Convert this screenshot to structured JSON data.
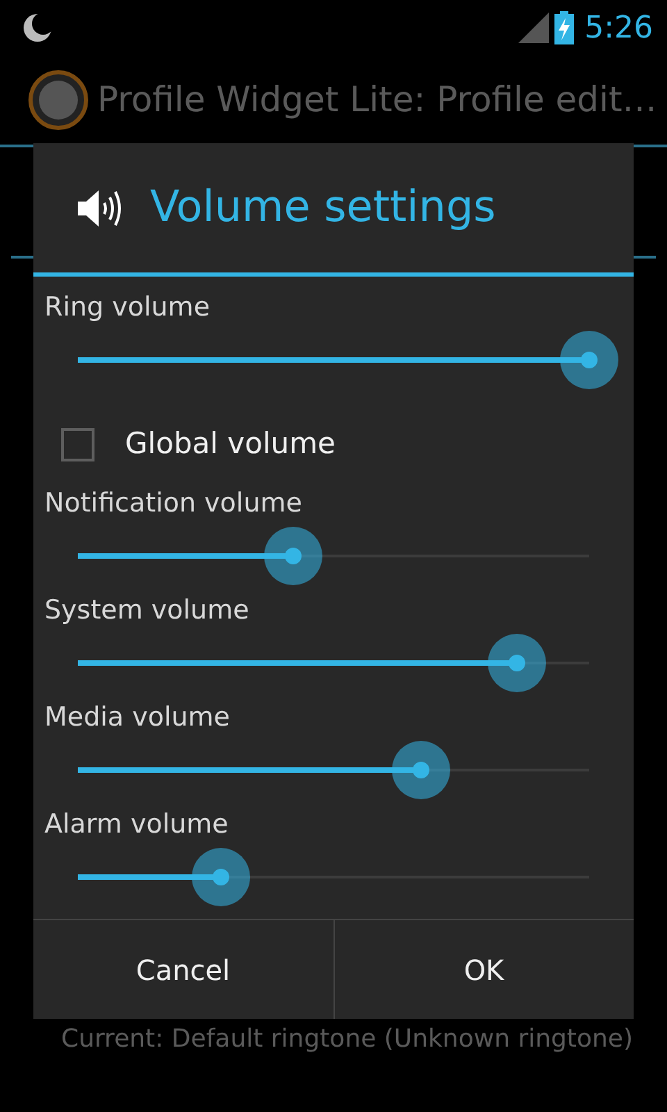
{
  "status_bar": {
    "time": "5:26"
  },
  "action_bar": {
    "title": "Profile Widget Lite: Profile edit…"
  },
  "dialog": {
    "title": "Volume settings",
    "rows": [
      {
        "kind": "slider",
        "label": "Ring volume",
        "level": 1.0
      },
      {
        "kind": "checkbox",
        "label": "Global volume",
        "checked": false
      },
      {
        "kind": "slider",
        "label": "Notification volume",
        "level": 0.42
      },
      {
        "kind": "slider",
        "label": "System volume",
        "level": 0.86
      },
      {
        "kind": "slider",
        "label": "Media volume",
        "level": 0.67
      },
      {
        "kind": "slider",
        "label": "Alarm volume",
        "level": 0.28
      }
    ],
    "buttons": [
      "Cancel",
      "OK"
    ]
  },
  "background_text": "Current: Default ringtone (Unknown ringtone)"
}
